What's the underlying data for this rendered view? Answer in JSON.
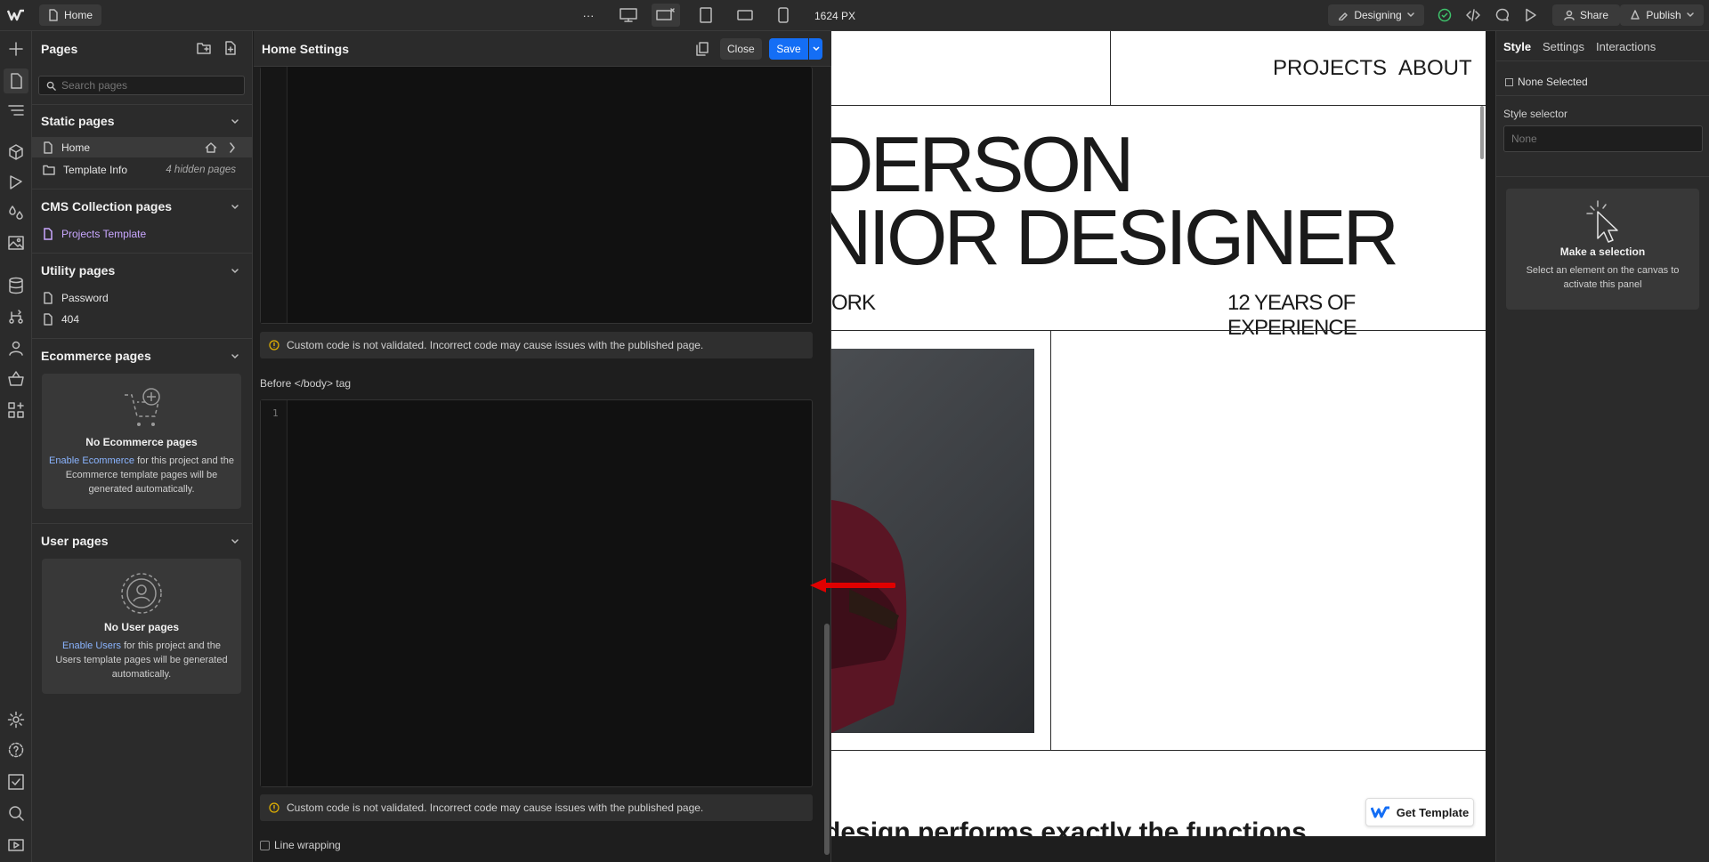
{
  "topbar": {
    "page_tab": "Home",
    "more": "···",
    "breakpoint_width": "1624 PX",
    "mode": "Designing",
    "share": "Share",
    "publish": "Publish"
  },
  "pages_panel": {
    "title": "Pages",
    "search_placeholder": "Search pages",
    "static_title": "Static pages",
    "static_items": [
      {
        "label": "Home",
        "note": ""
      },
      {
        "label": "Template Info",
        "note": "4 hidden pages"
      }
    ],
    "cms_title": "CMS Collection pages",
    "cms_items": [
      {
        "label": "Projects Template"
      }
    ],
    "utility_title": "Utility pages",
    "utility_items": [
      {
        "label": "Password"
      },
      {
        "label": "404"
      }
    ],
    "ecom_title": "Ecommerce pages",
    "ecom_card": {
      "title": "No Ecommerce pages",
      "link": "Enable Ecommerce",
      "rest": " for this project and the Ecommerce template pages will be generated automatically."
    },
    "user_title": "User pages",
    "user_card": {
      "title": "No User pages",
      "link": "Enable Users",
      "rest": " for this project and the Users template pages will be generated automatically."
    }
  },
  "settings": {
    "title": "Home Settings",
    "close": "Close",
    "save": "Save",
    "warning": "Custom code is not validated. Incorrect code may cause issues with the published page.",
    "before_body_label": "Before </body> tag",
    "line_number": "1",
    "line_wrapping": "Line wrapping"
  },
  "canvas": {
    "nav_projects": "PROJECTS",
    "nav_about": "ABOUT",
    "headline1": "DERSON",
    "headline2": "NIOR DESIGNER",
    "sub_left": "ORK",
    "sub_right": "12 YEARS OF EXPERIENCE",
    "bottom_text": "design performs exactly the functions",
    "get_template": "Get Template"
  },
  "right_panel": {
    "tab_style": "Style",
    "tab_settings": "Settings",
    "tab_interactions": "Interactions",
    "none_selected": "None Selected",
    "selector_label": "Style selector",
    "selector_placeholder": "None",
    "make_selection_title": "Make a selection",
    "make_selection_desc": "Select an element on the canvas to activate this panel"
  },
  "colors": {
    "accent": "#146ef5",
    "link": "#8ab4ff",
    "cms_item": "#c9a7ff",
    "arrow": "#e00000"
  }
}
